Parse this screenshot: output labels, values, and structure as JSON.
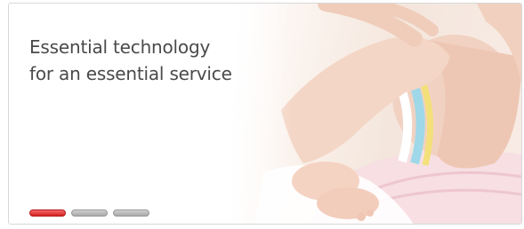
{
  "slide": {
    "headline_line1": "Essential technology",
    "headline_line2": "for an essential service"
  },
  "carousel": {
    "slide_count": 3,
    "active_index": 0,
    "indicator_labels": [
      "slide-1",
      "slide-2",
      "slide-3"
    ]
  },
  "colors": {
    "active_indicator": "#e03a3a",
    "inactive_indicator": "#b8b8b8",
    "headline_text": "#4a4a4a"
  }
}
